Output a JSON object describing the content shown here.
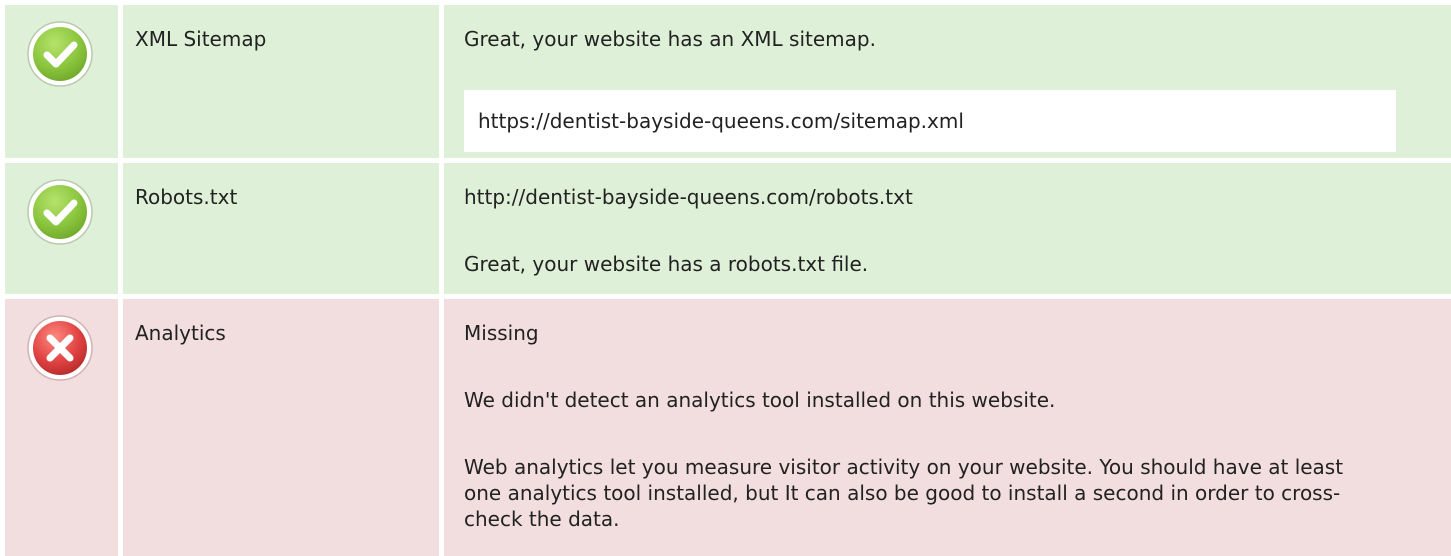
{
  "rows": [
    {
      "status": "pass",
      "icon": "check-circle-icon",
      "label": "XML Sitemap",
      "message": "Great, your website has an XML sitemap.",
      "url": "https://dentist-bayside-queens.com/sitemap.xml"
    },
    {
      "status": "pass",
      "icon": "check-circle-icon",
      "label": "Robots.txt",
      "url": "http://dentist-bayside-queens.com/robots.txt",
      "message": "Great, your website has a robots.txt file."
    },
    {
      "status": "fail",
      "icon": "error-circle-icon",
      "label": "Analytics",
      "status_text": "Missing",
      "message": "We didn't detect an analytics tool installed on this website.",
      "description": "Web analytics let you measure visitor activity on your website. You should have at least one analytics tool installed, but It can also be good to install a second in order to cross-check the data."
    }
  ],
  "colors": {
    "pass_background": "#dff0d8",
    "fail_background": "#f2dede",
    "pass_icon": "#8cc63f",
    "fail_icon": "#e04343"
  }
}
